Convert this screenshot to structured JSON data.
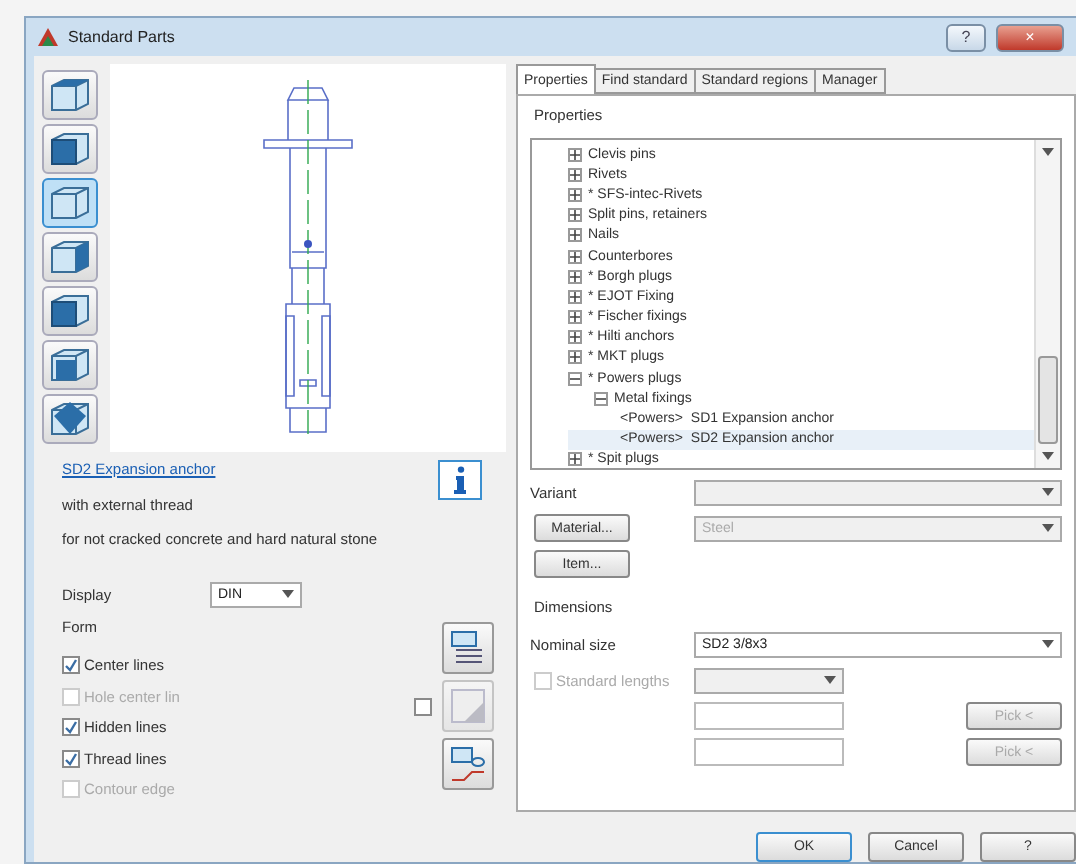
{
  "window": {
    "title": "Standard Parts",
    "help_button": "?",
    "close_button": "×"
  },
  "view_buttons": [
    {
      "selected": false
    },
    {
      "selected": false
    },
    {
      "selected": true
    },
    {
      "selected": false
    },
    {
      "selected": false
    },
    {
      "selected": false
    },
    {
      "selected": false
    }
  ],
  "part": {
    "name": "SD2 Expansion anchor",
    "lines": [
      "with external thread",
      "for not cracked concrete and hard natural stone"
    ]
  },
  "display": {
    "label": "Display",
    "value": "DIN"
  },
  "form": {
    "label": "Form",
    "options": [
      {
        "label": "Center lines",
        "checked": true,
        "disabled": false
      },
      {
        "label": "Hole center lin",
        "checked": false,
        "disabled": true
      },
      {
        "label": "Hidden lines",
        "checked": true,
        "disabled": false
      },
      {
        "label": "Thread lines",
        "checked": true,
        "disabled": false
      },
      {
        "label": "Contour edge",
        "checked": false,
        "disabled": true
      }
    ],
    "side_checkbox": {
      "checked": false
    }
  },
  "tabs": [
    {
      "label": "Properties",
      "selected": true
    },
    {
      "label": "Find standard",
      "selected": false
    },
    {
      "label": "Standard regions",
      "selected": false
    },
    {
      "label": "Manager",
      "selected": false
    }
  ],
  "properties": {
    "label": "Properties",
    "tree": [
      {
        "label": "Clevis pins",
        "expanded": false
      },
      {
        "label": "Rivets",
        "expanded": false
      },
      {
        "label": "* SFS-intec-Rivets",
        "expanded": false
      },
      {
        "label": "Split pins, retainers",
        "expanded": false
      },
      {
        "label": "Nails",
        "expanded": false
      },
      {
        "label": "Counterbores",
        "expanded": false
      },
      {
        "label": "* Borgh plugs",
        "expanded": false
      },
      {
        "label": "* EJOT Fixing",
        "expanded": false
      },
      {
        "label": "* Fischer fixings",
        "expanded": false
      },
      {
        "label": "* Hilti anchors",
        "expanded": false
      },
      {
        "label": "* MKT plugs",
        "expanded": false
      },
      {
        "label": "* Powers plugs",
        "expanded": true,
        "children": [
          {
            "label": "Metal fixings",
            "expanded": true,
            "children": [
              {
                "label": "<Powers>  SD1 Expansion anchor",
                "selected": false
              },
              {
                "label": "<Powers>  SD2 Expansion anchor",
                "selected": true
              }
            ]
          }
        ]
      },
      {
        "label": "* Spit plugs",
        "expanded": false
      }
    ]
  },
  "variant": {
    "label": "Variant"
  },
  "material": {
    "button": "Material...",
    "value": "Steel"
  },
  "item": {
    "button": "Item..."
  },
  "dimensions": {
    "label": "Dimensions",
    "nominal_size_label": "Nominal size",
    "nominal_size": "SD2 3/8x3",
    "standard_lengths": {
      "label": "Standard lengths",
      "checked": false
    },
    "pick_buttons": [
      "Pick <",
      "Pick <"
    ]
  },
  "buttons": [
    {
      "label": "OK",
      "default": true
    },
    {
      "label": "Cancel",
      "default": false
    },
    {
      "label": "?",
      "default": false
    }
  ]
}
